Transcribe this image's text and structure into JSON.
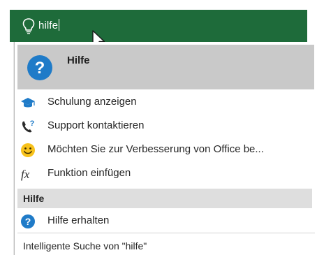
{
  "search": {
    "query": "hilfe",
    "icon": "lightbulb-icon"
  },
  "top_result": {
    "label": "Hilfe",
    "icon": "help-question-icon"
  },
  "actions": [
    {
      "label": "Schulung anzeigen",
      "icon": "graduation-cap-icon"
    },
    {
      "label": "Support kontaktieren",
      "icon": "phone-question-icon"
    },
    {
      "label": "Möchten Sie zur Verbesserung von Office be...",
      "icon": "smiley-icon"
    },
    {
      "label": "Funktion einfügen",
      "icon": "function-fx-icon"
    }
  ],
  "help_section": {
    "header": "Hilfe",
    "items": [
      {
        "label": "Hilfe erhalten",
        "icon": "help-question-icon"
      }
    ]
  },
  "smart_lookup": {
    "label": "Intelligente Suche von \"hilfe\""
  },
  "colors": {
    "title_bar": "#1e6b3a",
    "accent_blue": "#1f7bc8",
    "smiley_yellow": "#f7c21c",
    "highlight_gray": "#c9c9c9",
    "section_gray": "#dedede"
  }
}
